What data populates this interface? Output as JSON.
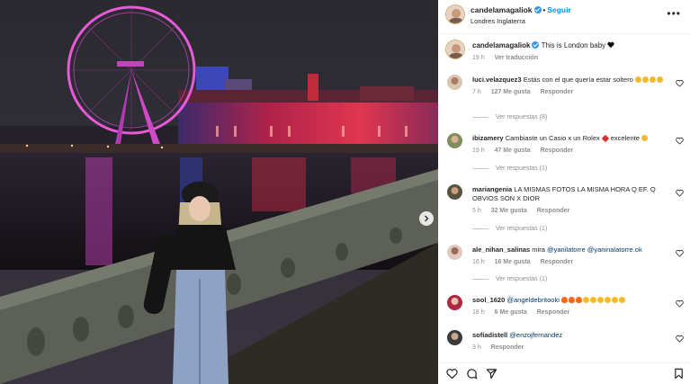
{
  "post": {
    "author": "candelamagaliok",
    "follow_label": "Seguir",
    "location": "Londres Inglaterra",
    "more_label": "•••",
    "caption_text": "This is London baby",
    "caption_time": "19 h",
    "see_translation": "Ver traducción"
  },
  "comments": [
    {
      "user": "luci.velazquez3",
      "text": "Estás con el que quería estar soltero",
      "time": "7 h",
      "likes": "127 Me gusta",
      "reply": "Responder",
      "replies": "Ver respuestas (8)"
    },
    {
      "user": "ibizamery",
      "text": "Cambiaste un Casio x un Rolex",
      "text2": "excelente",
      "time": "19 h",
      "likes": "47 Me gusta",
      "reply": "Responder",
      "replies": "Ver respuestas (1)"
    },
    {
      "user": "mariangenia",
      "text": "LA MISMAS FOTOS LA MISMA HORA Q EF. Q OBVIOS SON X DIOR",
      "time": "5 h",
      "likes": "32 Me gusta",
      "reply": "Responder",
      "replies": "Ver respuestas (1)"
    },
    {
      "user": "ale_nihan_salinas",
      "text": "mira",
      "mention1": "@yanilatorre",
      "mention2": "@yaninalatorre.ok",
      "time": "16 h",
      "likes": "16 Me gusta",
      "reply": "Responder",
      "replies": "Ver respuestas (1)"
    },
    {
      "user": "sool_1620",
      "mention1": "@angeldebritooki",
      "time": "18 h",
      "likes": "6 Me gusta",
      "reply": "Responder"
    },
    {
      "user": "sofiadistell",
      "mention1": "@enzojfernandez",
      "time": "3 h",
      "reply": "Responder"
    }
  ],
  "icons": [
    "verified-icon",
    "heart-icon",
    "comment-icon",
    "share-icon",
    "bookmark-icon",
    "chevron-right-icon"
  ],
  "colors": {
    "accent": "#0095f6",
    "mention": "#00376b",
    "muted": "#8e8e8e"
  }
}
